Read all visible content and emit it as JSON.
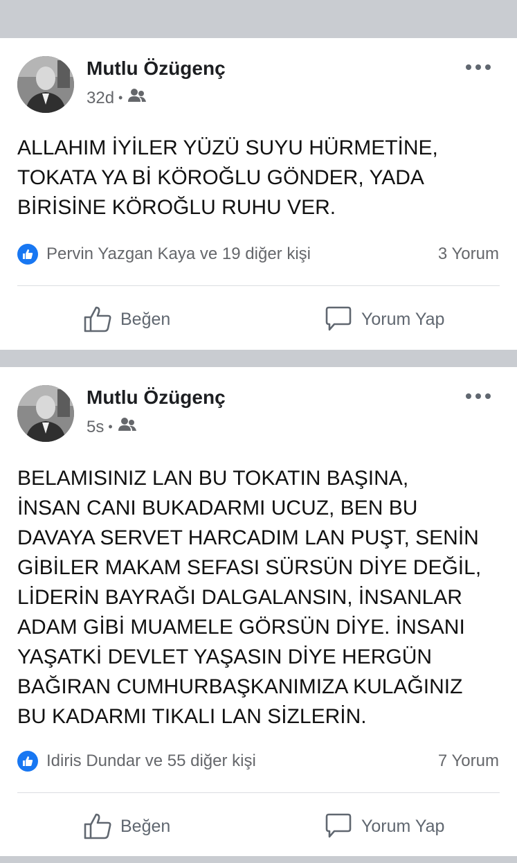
{
  "colors": {
    "separator": "#c9ccd1",
    "like_blue": "#1877f2",
    "meta_gray": "#65676b"
  },
  "posts": [
    {
      "author": "Mutlu Özügenç",
      "time": "32d",
      "audience_icon": "friends-icon",
      "text": "ALLAHIM İYİLER YÜZÜ SUYU HÜRMETİNE,\nTOKATA YA Bİ KÖROĞLU GÖNDER, YADA\nBİRİSİNE KÖROĞLU RUHU VER.",
      "reactions_text": "Pervin Yazgan Kaya ve 19 diğer kişi",
      "comments_text": "3 Yorum",
      "like_label": "Beğen",
      "comment_label": "Yorum Yap"
    },
    {
      "author": "Mutlu Özügenç",
      "time": "5s",
      "audience_icon": "friends-icon",
      "text": "BELAMISINIZ LAN BU TOKATIN BAŞINA,\nİNSAN CANI BUKADARMI UCUZ, BEN BU\nDAVAYA SERVET HARCADIM LAN PUŞT, SENİN\nGİBİLER MAKAM SEFASI SÜRSÜN DİYE DEĞİL,\nLİDERİN BAYRAĞI DALGALANSIN, İNSANLAR\nADAM GİBİ MUAMELE GÖRSÜN DİYE. İNSANI\nYAŞATKİ DEVLET YAŞASIN DİYE HERGÜN\nBAĞIRAN CUMHURBAŞKANIMIZA KULAĞINIZ\nBU KADARMI TIKALI LAN SİZLERİN.",
      "reactions_text": "Idiris Dundar ve 55 diğer kişi",
      "comments_text": "7 Yorum",
      "like_label": "Beğen",
      "comment_label": "Yorum Yap"
    }
  ]
}
